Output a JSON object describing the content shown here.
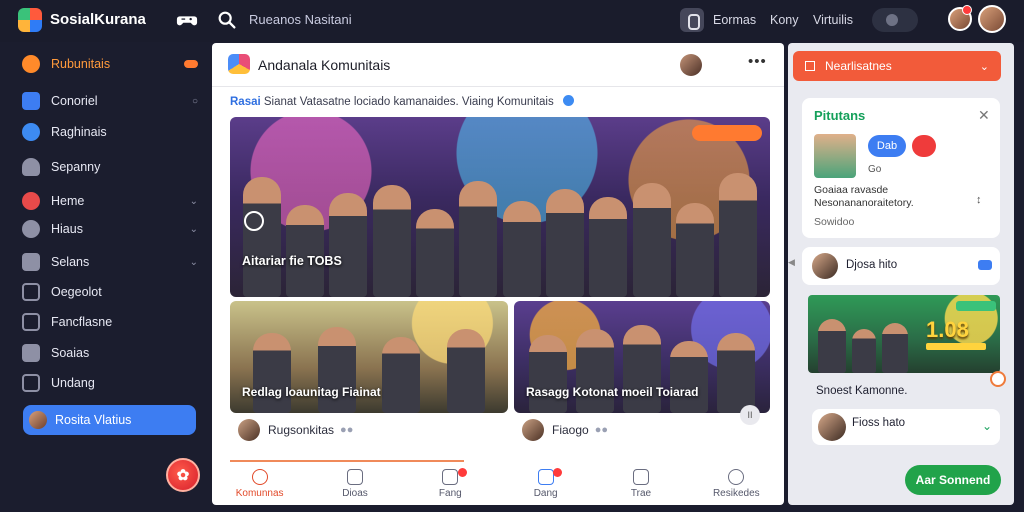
{
  "topbar": {
    "app_title": "SosialKurana",
    "search_label": "Rueanos Nasitani",
    "links": [
      "Eormas",
      "Kony",
      "Virtuilis"
    ]
  },
  "sidebar": {
    "top_item": "Rubunitais",
    "items": [
      {
        "label": "Conoriel",
        "icon": "grid-icon",
        "color": "#3d7df2"
      },
      {
        "label": "Raghinais",
        "icon": "check-circle-icon",
        "color": "#3d8bf2"
      },
      {
        "label": "Sepanny",
        "icon": "users-icon",
        "color": "#9a9cb0"
      },
      {
        "label": "Heme",
        "icon": "heart-icon",
        "color": "#e84a4a"
      },
      {
        "label": "Hiaus",
        "icon": "chat-icon",
        "color": "#9a9cb0"
      },
      {
        "label": "Selans",
        "icon": "layers-icon",
        "color": "#9a9cb0"
      },
      {
        "label": "Oegeolot",
        "icon": "square-icon",
        "color": "#9a9cb0"
      },
      {
        "label": "Fancflasne",
        "icon": "bookmark-icon",
        "color": "#9a9cb0"
      },
      {
        "label": "Soaias",
        "icon": "settings-icon",
        "color": "#9a9cb0"
      },
      {
        "label": "Undang",
        "icon": "folder-icon",
        "color": "#9a9cb0"
      }
    ],
    "selected": "Rosita Vlatius"
  },
  "main": {
    "group_title": "Andanala Komunitais",
    "subline_tag": "Rasai",
    "subline_text": "Sianat Vatasatne lociado kamanaides. Viaing Komunitais",
    "hero_label": "Aitariar fie TOBS",
    "card_left": {
      "caption": "Redlag loaunitag Fiainat",
      "user": "Rugsonkitas"
    },
    "card_right": {
      "caption": "Rasagg Kotonat moeil Toiarad",
      "user": "Fiaogo"
    },
    "nav": [
      {
        "label": "Komunnas",
        "active": true,
        "badge": false
      },
      {
        "label": "Dioas",
        "active": false,
        "badge": false
      },
      {
        "label": "Fang",
        "active": false,
        "badge": true
      },
      {
        "label": "Dang",
        "active": false,
        "badge": true
      },
      {
        "label": "Trae",
        "active": false,
        "badge": false
      },
      {
        "label": "Resikedes",
        "active": false,
        "badge": false
      }
    ]
  },
  "right": {
    "notif_label": "Nearlisatnes",
    "promo": {
      "title": "Pitutans",
      "pill_label": "Dab",
      "meta": "Go",
      "desc_1": "Goaiaa ravasde",
      "desc_2": "Nesonananoraitetory.",
      "foot": "Sowidoo"
    },
    "user_card_1": "Djosa hito",
    "mini_number": "1.08",
    "caption": "Snoest Kamonne.",
    "user_card_2": "Fioss hato",
    "cta_label": "Aar Sonnend"
  },
  "colors": {
    "accent": "#3d7df2",
    "brand_orange": "#f25b3a",
    "cta_green": "#21a34a"
  }
}
